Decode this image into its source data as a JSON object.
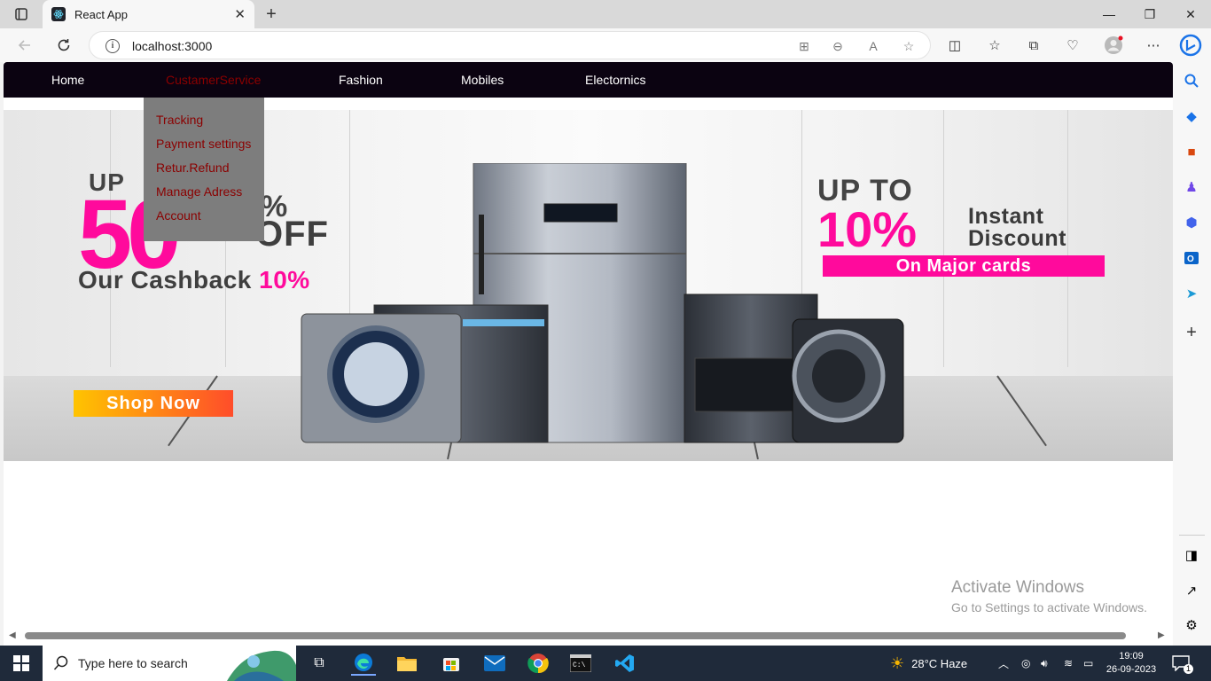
{
  "browser": {
    "tab_title": "React App",
    "url": "localhost:3000",
    "tab_close": "✕",
    "new_tab": "+"
  },
  "window_controls": {
    "minimize": "—",
    "maximize": "❐",
    "close": "✕"
  },
  "site_nav": {
    "items": [
      {
        "label": "Home",
        "active": false
      },
      {
        "label": "CustamerService",
        "active": true
      },
      {
        "label": "Fashion",
        "active": false
      },
      {
        "label": "Mobiles",
        "active": false
      },
      {
        "label": "Electornics",
        "active": false
      }
    ]
  },
  "dropdown": {
    "items": [
      "Tracking",
      "Payment settings",
      "Retur.Refund",
      "Manage Adress",
      "Account"
    ]
  },
  "banner": {
    "left": {
      "up": "UP",
      "big_number": "50",
      "percent": "%",
      "off": "OFF",
      "cashback": "Our Cashback",
      "cashback_pct": "10%",
      "shop_now": "Shop Now"
    },
    "right": {
      "up_to": "UP TO",
      "percent": "10%",
      "instant": "Instant",
      "discount": "Discount",
      "cards": "On Major cards"
    }
  },
  "watermark": {
    "line1": "Activate Windows",
    "line2": "Go to Settings to activate Windows."
  },
  "taskbar": {
    "search_placeholder": "Type here to search",
    "weather": "28°C  Haze",
    "time": "19:09",
    "date": "26-09-2023",
    "notifications": "1"
  },
  "colors": {
    "nav_bg": "#0b0311",
    "nav_active": "#8b0000",
    "dropdown_bg": "#7d7d7d",
    "accent_pink": "#ff0a9c"
  }
}
